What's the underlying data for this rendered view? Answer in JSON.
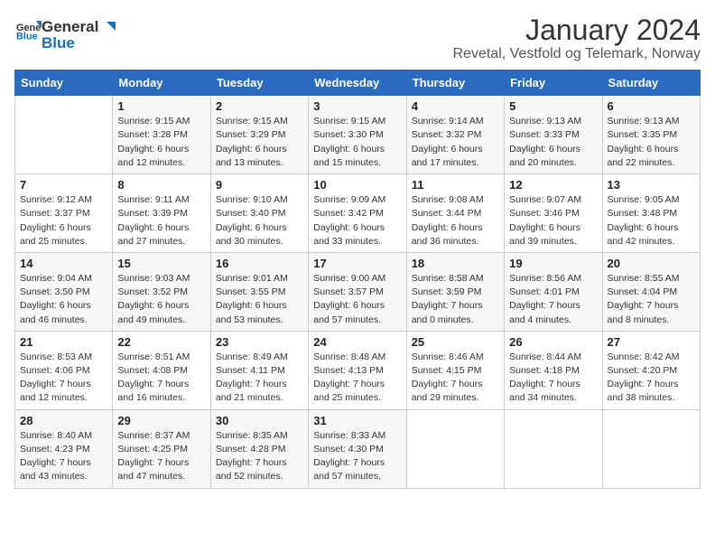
{
  "logo": {
    "text_general": "General",
    "text_blue": "Blue"
  },
  "header": {
    "title": "January 2024",
    "subtitle": "Revetal, Vestfold og Telemark, Norway"
  },
  "weekdays": [
    "Sunday",
    "Monday",
    "Tuesday",
    "Wednesday",
    "Thursday",
    "Friday",
    "Saturday"
  ],
  "weeks": [
    [
      {
        "day": "",
        "info": ""
      },
      {
        "day": "1",
        "info": "Sunrise: 9:15 AM\nSunset: 3:28 PM\nDaylight: 6 hours\nand 12 minutes."
      },
      {
        "day": "2",
        "info": "Sunrise: 9:15 AM\nSunset: 3:29 PM\nDaylight: 6 hours\nand 13 minutes."
      },
      {
        "day": "3",
        "info": "Sunrise: 9:15 AM\nSunset: 3:30 PM\nDaylight: 6 hours\nand 15 minutes."
      },
      {
        "day": "4",
        "info": "Sunrise: 9:14 AM\nSunset: 3:32 PM\nDaylight: 6 hours\nand 17 minutes."
      },
      {
        "day": "5",
        "info": "Sunrise: 9:13 AM\nSunset: 3:33 PM\nDaylight: 6 hours\nand 20 minutes."
      },
      {
        "day": "6",
        "info": "Sunrise: 9:13 AM\nSunset: 3:35 PM\nDaylight: 6 hours\nand 22 minutes."
      }
    ],
    [
      {
        "day": "7",
        "info": "Sunrise: 9:12 AM\nSunset: 3:37 PM\nDaylight: 6 hours\nand 25 minutes."
      },
      {
        "day": "8",
        "info": "Sunrise: 9:11 AM\nSunset: 3:39 PM\nDaylight: 6 hours\nand 27 minutes."
      },
      {
        "day": "9",
        "info": "Sunrise: 9:10 AM\nSunset: 3:40 PM\nDaylight: 6 hours\nand 30 minutes."
      },
      {
        "day": "10",
        "info": "Sunrise: 9:09 AM\nSunset: 3:42 PM\nDaylight: 6 hours\nand 33 minutes."
      },
      {
        "day": "11",
        "info": "Sunrise: 9:08 AM\nSunset: 3:44 PM\nDaylight: 6 hours\nand 36 minutes."
      },
      {
        "day": "12",
        "info": "Sunrise: 9:07 AM\nSunset: 3:46 PM\nDaylight: 6 hours\nand 39 minutes."
      },
      {
        "day": "13",
        "info": "Sunrise: 9:05 AM\nSunset: 3:48 PM\nDaylight: 6 hours\nand 42 minutes."
      }
    ],
    [
      {
        "day": "14",
        "info": "Sunrise: 9:04 AM\nSunset: 3:50 PM\nDaylight: 6 hours\nand 46 minutes."
      },
      {
        "day": "15",
        "info": "Sunrise: 9:03 AM\nSunset: 3:52 PM\nDaylight: 6 hours\nand 49 minutes."
      },
      {
        "day": "16",
        "info": "Sunrise: 9:01 AM\nSunset: 3:55 PM\nDaylight: 6 hours\nand 53 minutes."
      },
      {
        "day": "17",
        "info": "Sunrise: 9:00 AM\nSunset: 3:57 PM\nDaylight: 6 hours\nand 57 minutes."
      },
      {
        "day": "18",
        "info": "Sunrise: 8:58 AM\nSunset: 3:59 PM\nDaylight: 7 hours\nand 0 minutes."
      },
      {
        "day": "19",
        "info": "Sunrise: 8:56 AM\nSunset: 4:01 PM\nDaylight: 7 hours\nand 4 minutes."
      },
      {
        "day": "20",
        "info": "Sunrise: 8:55 AM\nSunset: 4:04 PM\nDaylight: 7 hours\nand 8 minutes."
      }
    ],
    [
      {
        "day": "21",
        "info": "Sunrise: 8:53 AM\nSunset: 4:06 PM\nDaylight: 7 hours\nand 12 minutes."
      },
      {
        "day": "22",
        "info": "Sunrise: 8:51 AM\nSunset: 4:08 PM\nDaylight: 7 hours\nand 16 minutes."
      },
      {
        "day": "23",
        "info": "Sunrise: 8:49 AM\nSunset: 4:11 PM\nDaylight: 7 hours\nand 21 minutes."
      },
      {
        "day": "24",
        "info": "Sunrise: 8:48 AM\nSunset: 4:13 PM\nDaylight: 7 hours\nand 25 minutes."
      },
      {
        "day": "25",
        "info": "Sunrise: 8:46 AM\nSunset: 4:15 PM\nDaylight: 7 hours\nand 29 minutes."
      },
      {
        "day": "26",
        "info": "Sunrise: 8:44 AM\nSunset: 4:18 PM\nDaylight: 7 hours\nand 34 minutes."
      },
      {
        "day": "27",
        "info": "Sunrise: 8:42 AM\nSunset: 4:20 PM\nDaylight: 7 hours\nand 38 minutes."
      }
    ],
    [
      {
        "day": "28",
        "info": "Sunrise: 8:40 AM\nSunset: 4:23 PM\nDaylight: 7 hours\nand 43 minutes."
      },
      {
        "day": "29",
        "info": "Sunrise: 8:37 AM\nSunset: 4:25 PM\nDaylight: 7 hours\nand 47 minutes."
      },
      {
        "day": "30",
        "info": "Sunrise: 8:35 AM\nSunset: 4:28 PM\nDaylight: 7 hours\nand 52 minutes."
      },
      {
        "day": "31",
        "info": "Sunrise: 8:33 AM\nSunset: 4:30 PM\nDaylight: 7 hours\nand 57 minutes."
      },
      {
        "day": "",
        "info": ""
      },
      {
        "day": "",
        "info": ""
      },
      {
        "day": "",
        "info": ""
      }
    ]
  ]
}
